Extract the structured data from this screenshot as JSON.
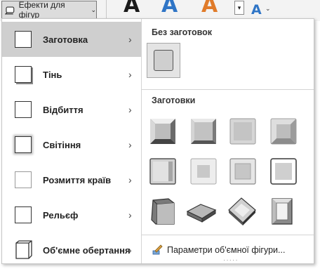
{
  "ribbon": {
    "shape_effects_label": "Ефекти для фігур",
    "letters": [
      {
        "char": "A",
        "color": "#1a1a1a"
      },
      {
        "char": "A",
        "color": "#2f75c6"
      },
      {
        "char": "A",
        "color": "#e07b2a"
      }
    ],
    "text_effects_letter": "A"
  },
  "menu": {
    "items": [
      {
        "label": "Заготовка",
        "selected": true
      },
      {
        "label": "Тінь",
        "selected": false
      },
      {
        "label": "Відбиття",
        "selected": false
      },
      {
        "label": "Світіння",
        "selected": false
      },
      {
        "label": "Розмиття країв",
        "selected": false
      },
      {
        "label": "Рельєф",
        "selected": false
      },
      {
        "label": "Об'ємне обертання",
        "selected": false
      }
    ],
    "submenu_arrow": "›"
  },
  "gallery": {
    "no_presets_title": "Без заготовок",
    "presets_title": "Заготовки",
    "three_d_options_label": "Параметри об'ємної фігури...",
    "grip": "·····"
  }
}
